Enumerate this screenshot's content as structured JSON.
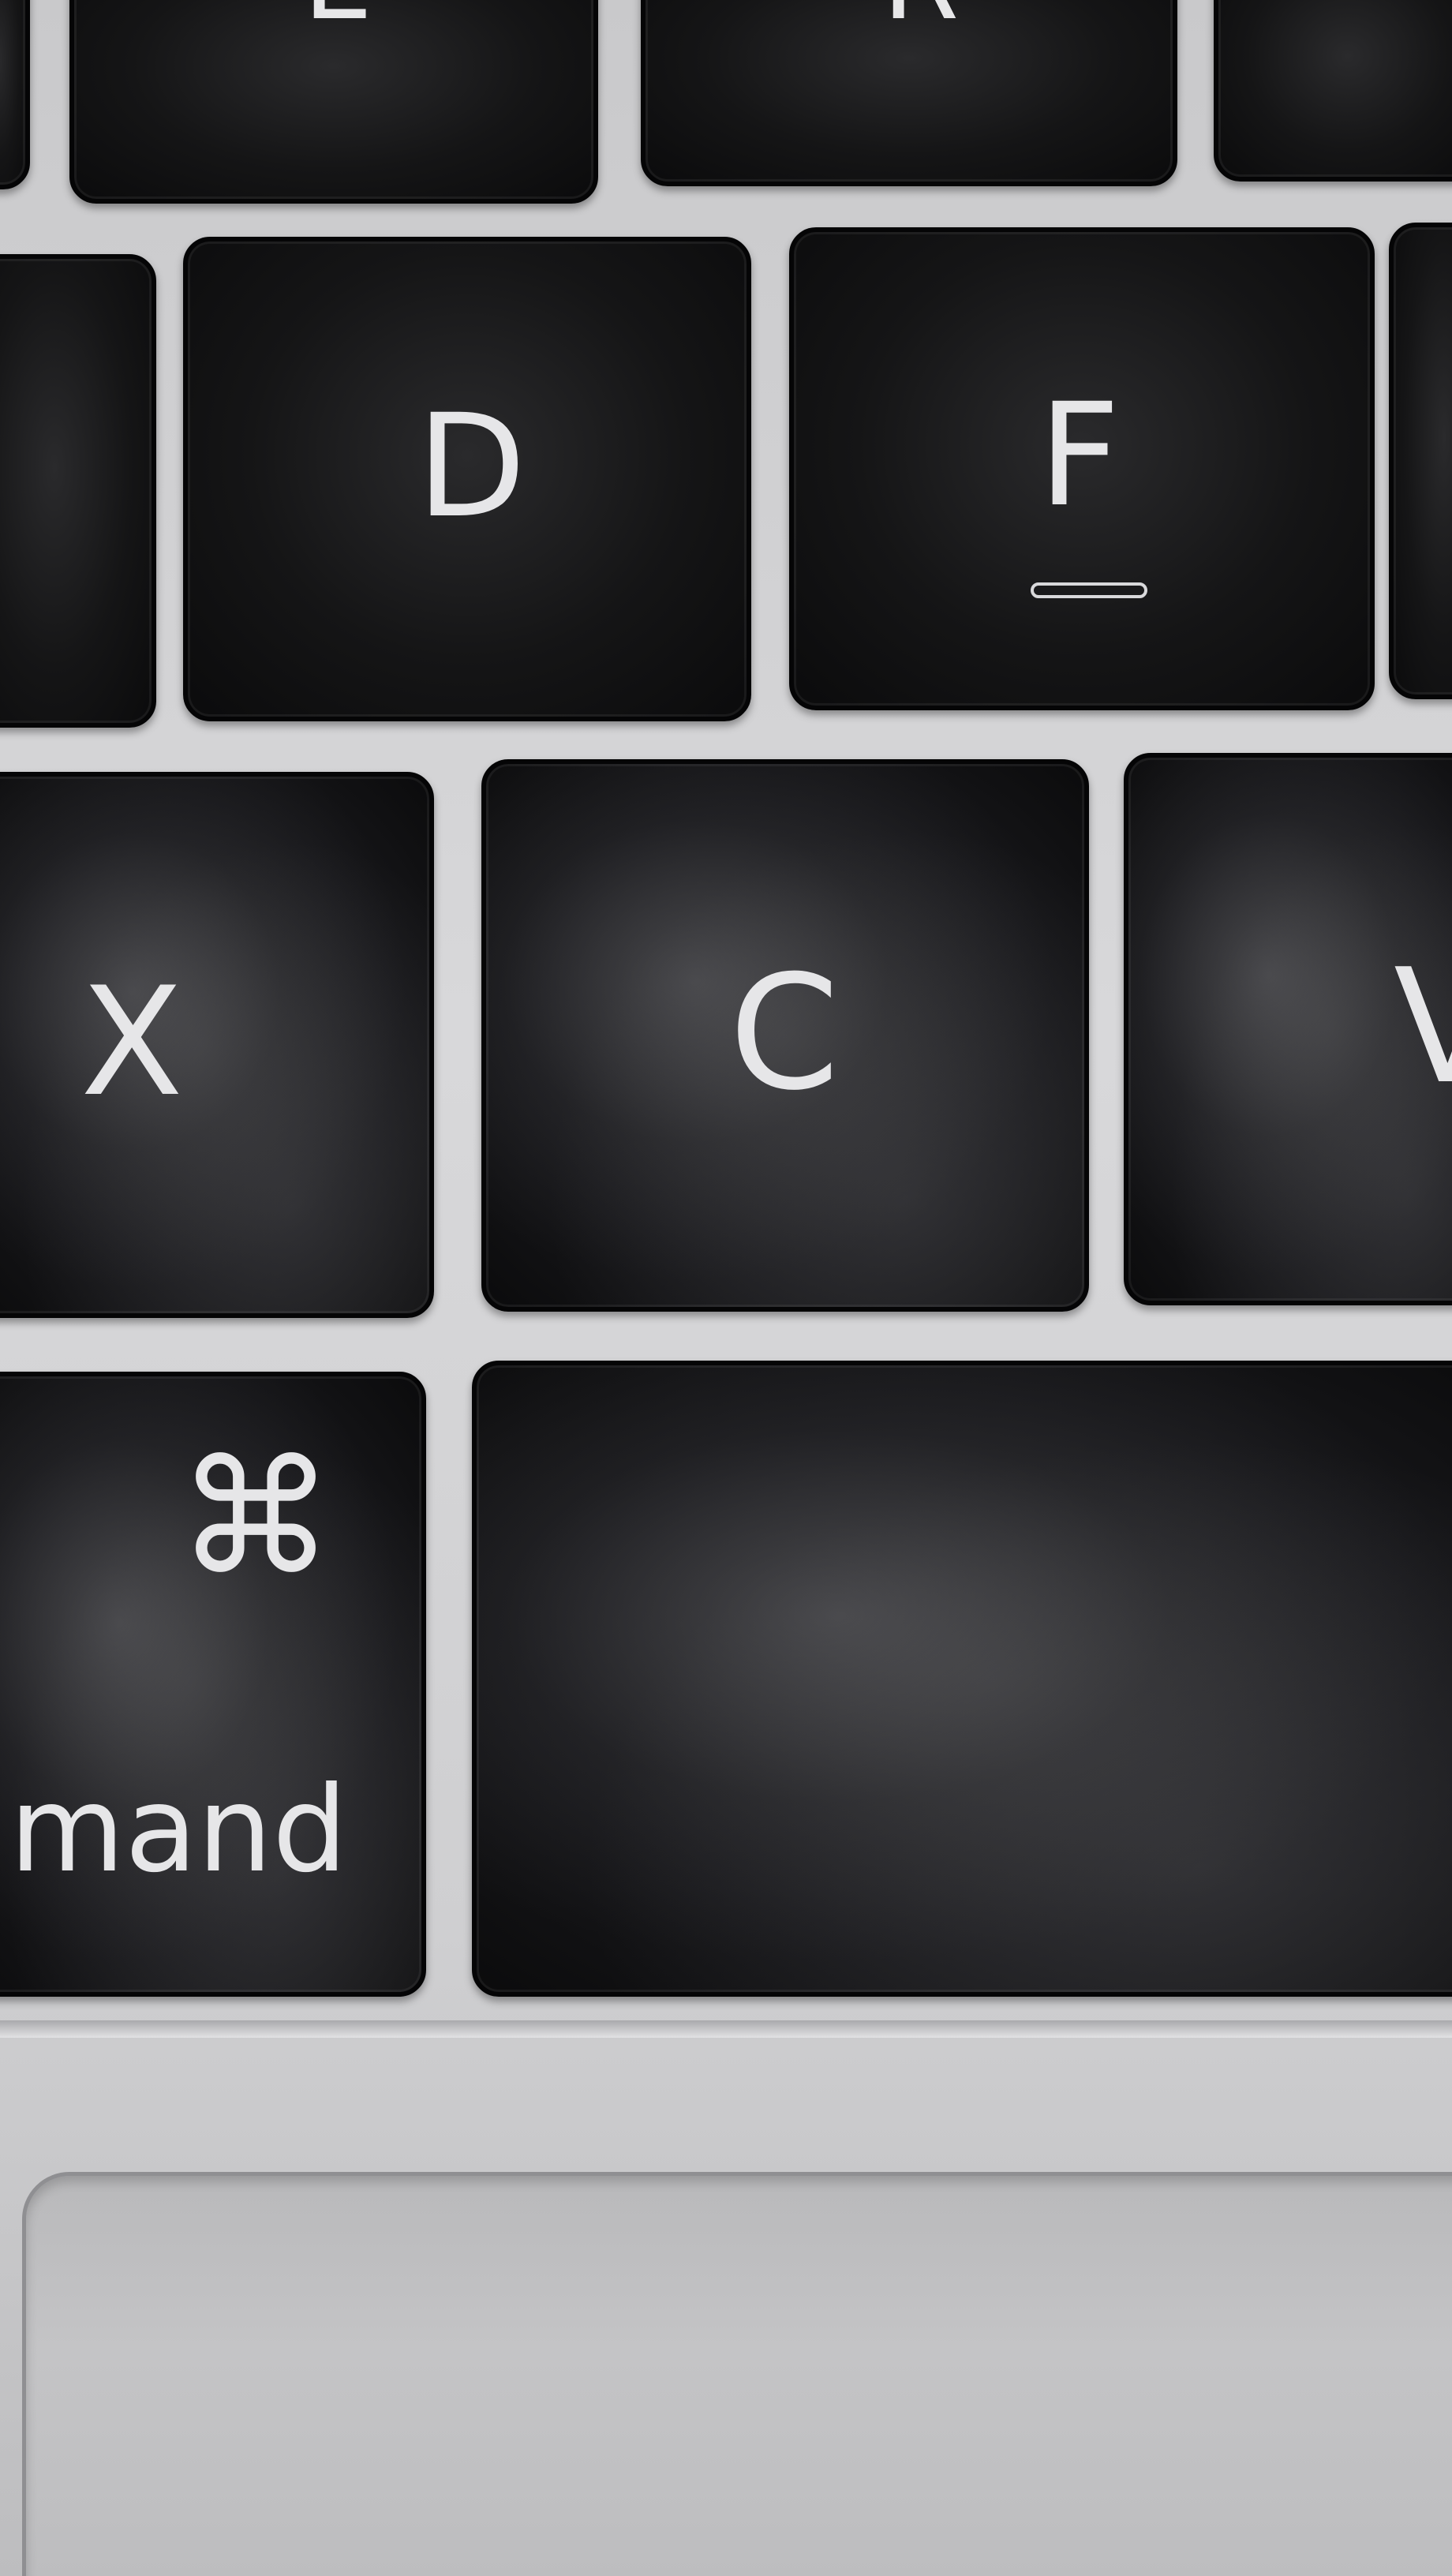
{
  "keys": {
    "e": "E",
    "r": "R",
    "d": "D",
    "f": "F",
    "x": "X",
    "c": "C",
    "v": "V",
    "command_symbol": "⌘",
    "command_label": "mand"
  }
}
